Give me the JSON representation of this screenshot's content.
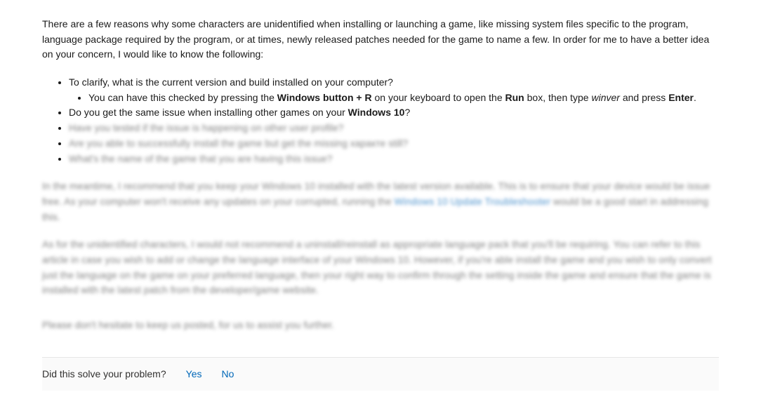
{
  "intro": "There are a few reasons why some characters are unidentified when installing or launching a game, like missing system files specific to the program, language package required by the program, or at times, newly released patches needed for the game to name a few. In order for me to have a better idea on your concern, I would like to know the following:",
  "bullets": {
    "b1": "To clarify, what is the current version and build installed on your computer?",
    "b1a_pre": "You can have this checked by pressing the ",
    "b1a_bold1": "Windows button + R",
    "b1a_mid1": " on your keyboard to open the ",
    "b1a_bold2": "Run",
    "b1a_mid2": " box, then type ",
    "b1a_italic1": "winver",
    "b1a_mid3": " and press ",
    "b1a_bold3": "Enter",
    "b1a_end": ".",
    "b2_pre": "Do you get the same issue when installing other games on your ",
    "b2_bold": "Windows 10",
    "b2_end": "?",
    "b3": "Have you tested if the issue is happening on other user profile?",
    "b4": "Are you able to successfully install the game but get the missing характе still?",
    "b5": "What's the name of the game that you are having this issue?"
  },
  "para1_a": "In the meantime, I recommend that you keep your Windows 10 installed with the latest version available. This is to ensure that your device would be issue free. As your computer won't receive any updates on your corrupted, running the ",
  "para1_link": "Windows 10 Update Troubleshooter",
  "para1_b": " would be a good start in addressing this.",
  "para2": "As for the unidentified characters, I would not recommend a uninstall/reinstall as appropriate language pack that you'll be requiring. You can refer to this article in case you wish to add or change the language interface of your Windows 10. However, if you're able install the game and you wish to only convert just the language on the game on your preferred language, then your right way to confirm through the setting inside the game and ensure that the game is installed with the latest patch from the developer/game website.",
  "para3": "Please don't hesitate to keep us posted, for us to assist you further.",
  "footer": {
    "question": "Did this solve your problem?",
    "yes": "Yes",
    "no": "No"
  }
}
